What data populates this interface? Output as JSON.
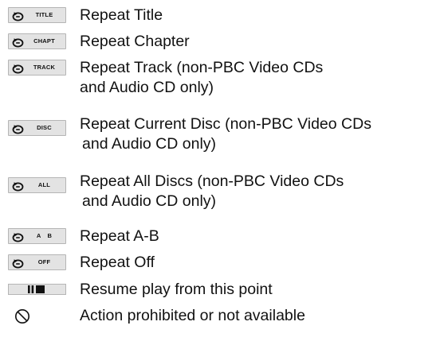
{
  "legend": {
    "items": [
      {
        "icon": "repeat-title-icon",
        "badge": "TITLE",
        "lines": [
          "Repeat Title"
        ]
      },
      {
        "icon": "repeat-chapter-icon",
        "badge": "CHAPT",
        "lines": [
          "Repeat Chapter"
        ]
      },
      {
        "icon": "repeat-track-icon",
        "badge": "TRACK",
        "lines": [
          "Repeat Track (non-PBC Video CDs",
          "and Audio CD only)"
        ]
      },
      {
        "icon": "repeat-disc-icon",
        "badge": "DISC",
        "lines": [
          "Repeat Current Disc (non-PBC Video CDs",
          "and Audio CD only)"
        ]
      },
      {
        "icon": "repeat-all-icon",
        "badge": "ALL",
        "lines": [
          "Repeat All Discs (non-PBC Video CDs",
          "and Audio CD only)"
        ]
      },
      {
        "icon": "repeat-a-b-icon",
        "badge": "A B",
        "lines": [
          "Repeat A-B"
        ]
      },
      {
        "icon": "repeat-off-icon",
        "badge": "OFF",
        "lines": [
          "Repeat Off"
        ]
      },
      {
        "icon": "resume-icon",
        "badge": "",
        "lines": [
          "Resume play from this point"
        ]
      },
      {
        "icon": "prohibited-icon",
        "badge": "",
        "lines": [
          "Action prohibited or not available"
        ]
      }
    ]
  },
  "colors": {
    "text": "#111111",
    "badge_fill": "#e3e3e3",
    "badge_border": "#b5b5b5"
  }
}
